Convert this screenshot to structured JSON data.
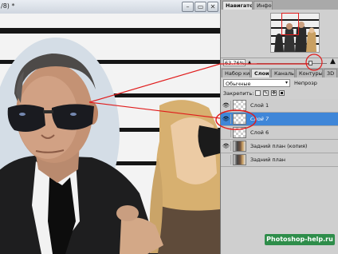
{
  "document": {
    "title": "/8) *",
    "buttons": [
      "–",
      "▭",
      "✕"
    ]
  },
  "navigator_panel": {
    "tabs": [
      "Навигатор",
      "Инфо"
    ],
    "zoom": "63.76%"
  },
  "layers_panel": {
    "tabs": [
      "Набор кист",
      "Слои",
      "Каналы",
      "Контуры",
      "3D"
    ],
    "blend_mode": "Обычные",
    "opacity_label": "Непрозр",
    "lock_label": "Закрепить:",
    "layers": [
      {
        "name": "Слой 1",
        "visible": true,
        "thumb": "transparent",
        "selected": false
      },
      {
        "name": "Слой 7",
        "visible": true,
        "thumb": "transparent",
        "selected": true
      },
      {
        "name": "Слой 6",
        "visible": false,
        "thumb": "transparent",
        "selected": false
      },
      {
        "name": "Задний план (копия)",
        "visible": true,
        "thumb": "photo",
        "selected": false
      },
      {
        "name": "Задний план",
        "visible": false,
        "thumb": "photo",
        "selected": false
      }
    ]
  },
  "watermark": "Photoshop-help.ru",
  "colors": {
    "selection": "#3f86d8",
    "annotation": "#e01b1b"
  }
}
